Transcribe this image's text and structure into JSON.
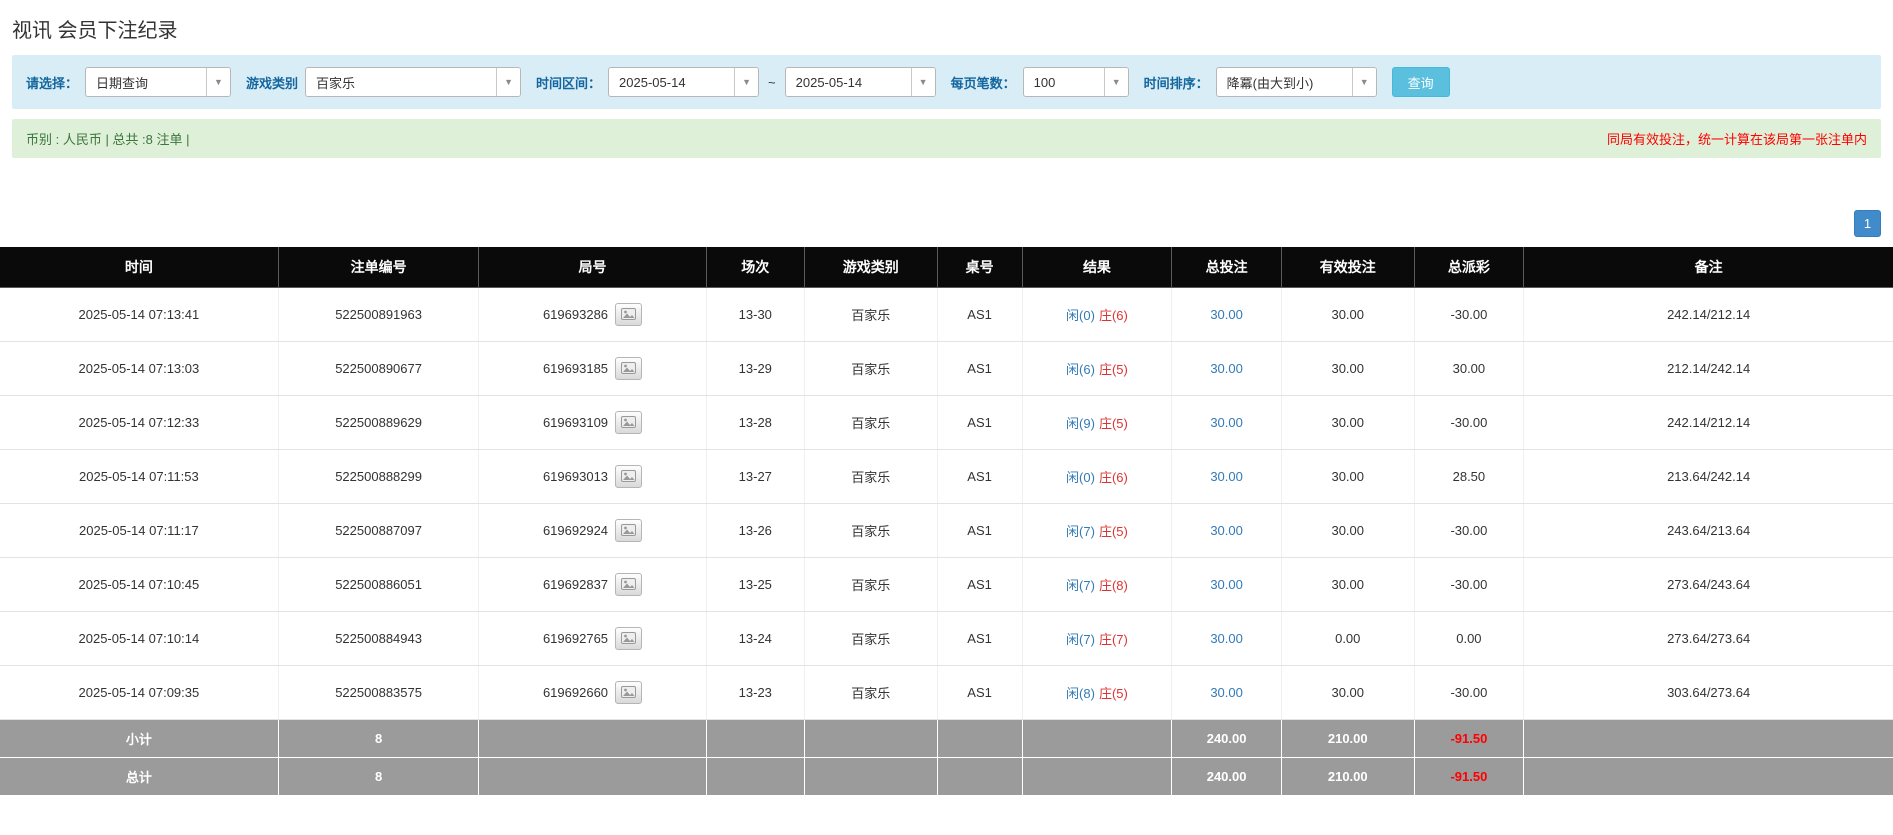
{
  "page": {
    "title": "视讯 会员下注纪录"
  },
  "colors": {
    "accent_blue": "#428bca",
    "search_button": "#5bc0de",
    "filter_bar_bg": "#d9edf7",
    "summary_bar_bg": "#dff0d8",
    "summary_text_green": "#3c763d",
    "negative_red": "#ff0000",
    "player_blue": "#337ab7",
    "banker_red": "#dd3333",
    "header_bg": "#0a0a0a",
    "footer_bg": "#9b9b9b"
  },
  "filters": {
    "select_label": "请选择：",
    "select_value": "日期查询",
    "game_type_label": "游戏类别",
    "game_type_value": "百家乐",
    "date_range_label": "时间区间：",
    "date_from": "2025-05-14",
    "date_separator": "~",
    "date_to": "2025-05-14",
    "page_size_label": "每页笔数：",
    "page_size_value": "100",
    "sort_label": "时间排序：",
    "sort_value": "降冪(由大到小)",
    "search_button": "查询",
    "caret": "▼"
  },
  "summary": {
    "left_text": "币别 : 人民币 | 总共 :8 注单 |",
    "right_text": "同局有效投注，统一计算在该局第一张注单内"
  },
  "pagination": {
    "current": "1"
  },
  "table": {
    "headers": [
      "时间",
      "注单编号",
      "局号",
      "场次",
      "游戏类别",
      "桌号",
      "结果",
      "总投注",
      "有效投注",
      "总派彩",
      "备注"
    ],
    "rows": [
      {
        "time": "2025-05-14 07:13:41",
        "bet_id": "522500891963",
        "round_id": "619693286",
        "session": "13-30",
        "game": "百家乐",
        "table": "AS1",
        "player": "闲(0)",
        "banker": "庄(6)",
        "total_bet": "30.00",
        "valid_bet": "30.00",
        "payout": "-30.00",
        "note": "242.14/212.14"
      },
      {
        "time": "2025-05-14 07:13:03",
        "bet_id": "522500890677",
        "round_id": "619693185",
        "session": "13-29",
        "game": "百家乐",
        "table": "AS1",
        "player": "闲(6)",
        "banker": "庄(5)",
        "total_bet": "30.00",
        "valid_bet": "30.00",
        "payout": "30.00",
        "note": "212.14/242.14"
      },
      {
        "time": "2025-05-14 07:12:33",
        "bet_id": "522500889629",
        "round_id": "619693109",
        "session": "13-28",
        "game": "百家乐",
        "table": "AS1",
        "player": "闲(9)",
        "banker": "庄(5)",
        "total_bet": "30.00",
        "valid_bet": "30.00",
        "payout": "-30.00",
        "note": "242.14/212.14"
      },
      {
        "time": "2025-05-14 07:11:53",
        "bet_id": "522500888299",
        "round_id": "619693013",
        "session": "13-27",
        "game": "百家乐",
        "table": "AS1",
        "player": "闲(0)",
        "banker": "庄(6)",
        "total_bet": "30.00",
        "valid_bet": "30.00",
        "payout": "28.50",
        "note": "213.64/242.14"
      },
      {
        "time": "2025-05-14 07:11:17",
        "bet_id": "522500887097",
        "round_id": "619692924",
        "session": "13-26",
        "game": "百家乐",
        "table": "AS1",
        "player": "闲(7)",
        "banker": "庄(5)",
        "total_bet": "30.00",
        "valid_bet": "30.00",
        "payout": "-30.00",
        "note": "243.64/213.64"
      },
      {
        "time": "2025-05-14 07:10:45",
        "bet_id": "522500886051",
        "round_id": "619692837",
        "session": "13-25",
        "game": "百家乐",
        "table": "AS1",
        "player": "闲(7)",
        "banker": "庄(8)",
        "total_bet": "30.00",
        "valid_bet": "30.00",
        "payout": "-30.00",
        "note": "273.64/243.64"
      },
      {
        "time": "2025-05-14 07:10:14",
        "bet_id": "522500884943",
        "round_id": "619692765",
        "session": "13-24",
        "game": "百家乐",
        "table": "AS1",
        "player": "闲(7)",
        "banker": "庄(7)",
        "total_bet": "30.00",
        "valid_bet": "0.00",
        "payout": "0.00",
        "note": "273.64/273.64"
      },
      {
        "time": "2025-05-14 07:09:35",
        "bet_id": "522500883575",
        "round_id": "619692660",
        "session": "13-23",
        "game": "百家乐",
        "table": "AS1",
        "player": "闲(8)",
        "banker": "庄(5)",
        "total_bet": "30.00",
        "valid_bet": "30.00",
        "payout": "-30.00",
        "note": "303.64/273.64"
      }
    ],
    "subtotal": {
      "label": "小计",
      "count": "8",
      "total_bet": "240.00",
      "valid_bet": "210.00",
      "payout": "-91.50"
    },
    "total": {
      "label": "总计",
      "count": "8",
      "total_bet": "240.00",
      "valid_bet": "210.00",
      "payout": "-91.50"
    }
  }
}
